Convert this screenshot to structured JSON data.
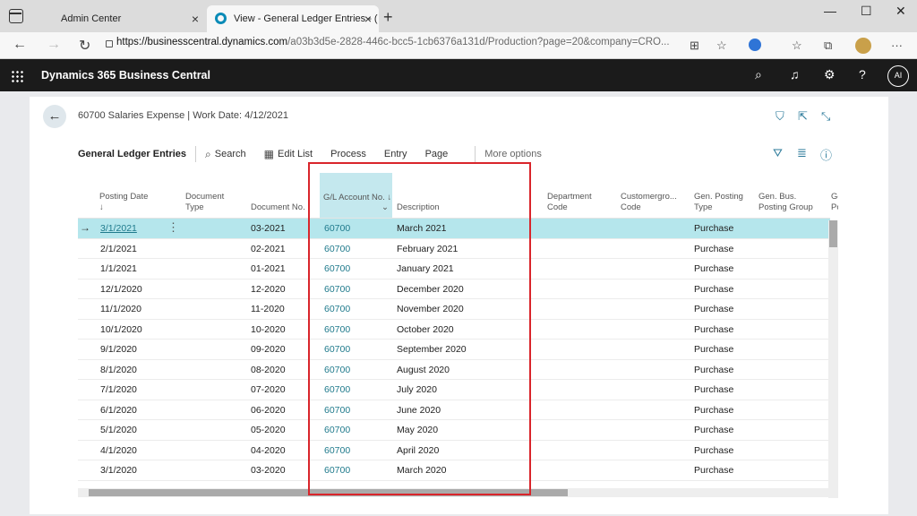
{
  "browser": {
    "tabs": [
      {
        "title": "Admin Center",
        "close": "×"
      },
      {
        "title": "View - General Ledger Entries - (",
        "close": "×"
      }
    ],
    "new_tab": "+",
    "window_controls": {
      "minimize": "—",
      "maximize": "☐",
      "close": "✕"
    },
    "url_host": "https://businesscentral.dynamics.com",
    "url_rest": "/a03b3d5e-2828-446c-bcc5-1cb6376a131d/Production?page=20&company=CRO..."
  },
  "app": {
    "title": "Dynamics 365 Business Central",
    "avatar_initials": "AI"
  },
  "page": {
    "caption": "60700 Salaries Expense | Work Date: 4/12/2021",
    "name": "General Ledger Entries",
    "actions": {
      "search": "Search",
      "edit_list": "Edit List",
      "process": "Process",
      "entry": "Entry",
      "page": "Page",
      "more": "More options"
    }
  },
  "grid": {
    "columns": {
      "posting_date": "Posting Date",
      "posting_date_sort": "↓",
      "document_type": "Document Type",
      "document_no": "Document No.",
      "gl_account": "G/L Account No. ↓",
      "description": "Description",
      "department_code": "Department Code",
      "customergroup_code": "Customergro... Code",
      "gen_posting_type": "Gen. Posting Type",
      "gen_bus_posting_group": "Gen. Bus. Posting Group",
      "gen_prod_partial": "Ge Po"
    },
    "rows": [
      {
        "date": "3/1/2021",
        "doc_no": "03-2021",
        "account": "60700",
        "description": "March 2021",
        "posting_type": "Purchase"
      },
      {
        "date": "2/1/2021",
        "doc_no": "02-2021",
        "account": "60700",
        "description": "February 2021",
        "posting_type": "Purchase"
      },
      {
        "date": "1/1/2021",
        "doc_no": "01-2021",
        "account": "60700",
        "description": "January 2021",
        "posting_type": "Purchase"
      },
      {
        "date": "12/1/2020",
        "doc_no": "12-2020",
        "account": "60700",
        "description": "December 2020",
        "posting_type": "Purchase"
      },
      {
        "date": "11/1/2020",
        "doc_no": "11-2020",
        "account": "60700",
        "description": "November 2020",
        "posting_type": "Purchase"
      },
      {
        "date": "10/1/2020",
        "doc_no": "10-2020",
        "account": "60700",
        "description": "October 2020",
        "posting_type": "Purchase"
      },
      {
        "date": "9/1/2020",
        "doc_no": "09-2020",
        "account": "60700",
        "description": "September 2020",
        "posting_type": "Purchase"
      },
      {
        "date": "8/1/2020",
        "doc_no": "08-2020",
        "account": "60700",
        "description": "August 2020",
        "posting_type": "Purchase"
      },
      {
        "date": "7/1/2020",
        "doc_no": "07-2020",
        "account": "60700",
        "description": "July 2020",
        "posting_type": "Purchase"
      },
      {
        "date": "6/1/2020",
        "doc_no": "06-2020",
        "account": "60700",
        "description": "June 2020",
        "posting_type": "Purchase"
      },
      {
        "date": "5/1/2020",
        "doc_no": "05-2020",
        "account": "60700",
        "description": "May 2020",
        "posting_type": "Purchase"
      },
      {
        "date": "4/1/2020",
        "doc_no": "04-2020",
        "account": "60700",
        "description": "April 2020",
        "posting_type": "Purchase"
      },
      {
        "date": "3/1/2020",
        "doc_no": "03-2020",
        "account": "60700",
        "description": "March 2020",
        "posting_type": "Purchase"
      }
    ]
  },
  "colors": {
    "active_row": "#b5e6ec",
    "link": "#1f7a8c",
    "highlight_box": "#d9252b",
    "appbar": "#1b1b1b"
  }
}
